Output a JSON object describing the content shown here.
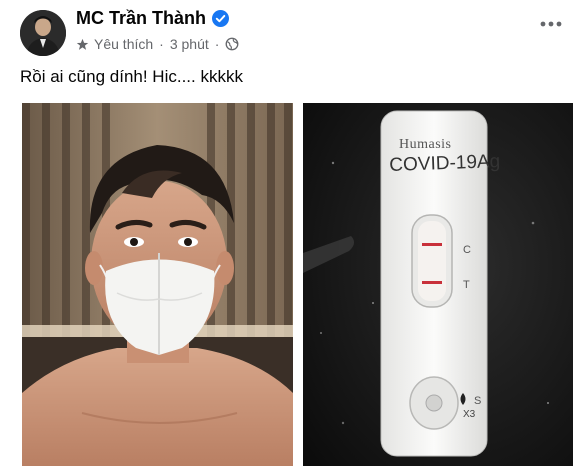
{
  "post": {
    "author": "MC Trần Thành",
    "badge": "Yêu thích",
    "time": "3 phút",
    "caption": "Rồi ai cũng dính! Hic.... kkkkk"
  },
  "test_kit": {
    "brand": "Humasis",
    "product": "COVID-19Ag",
    "mark_c": "C",
    "mark_t": "T",
    "mark_s": "S",
    "drops": "X3"
  },
  "icons": [
    "avatar-image",
    "verified-badge-icon",
    "star-icon",
    "globe-icon",
    "more-options-icon"
  ],
  "colors": {
    "verified_blue": "#1877f2",
    "meta_gray": "#65676b",
    "test_line_red": "#c8303a"
  }
}
